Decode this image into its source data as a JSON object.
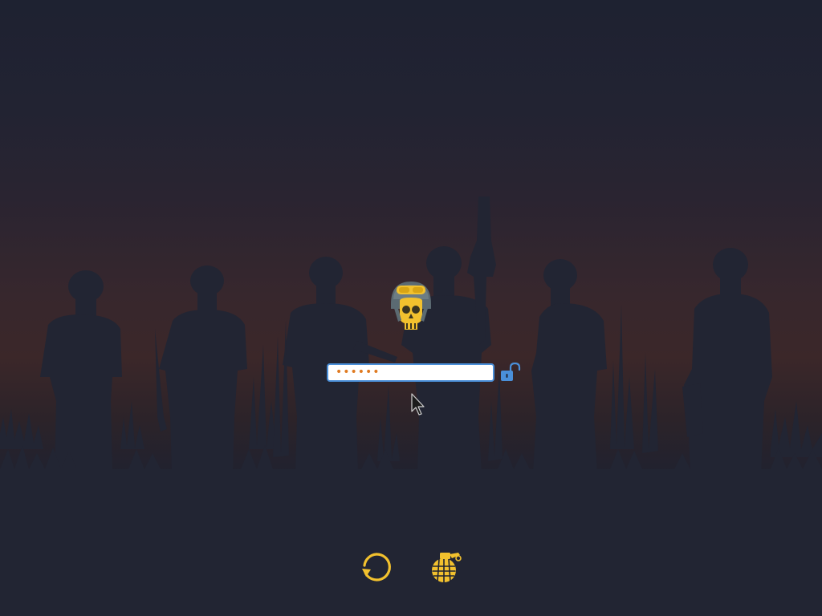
{
  "lockscreen": {
    "password": {
      "masked_value": "••••••",
      "mask_char_count": 6
    },
    "icons": {
      "avatar": "skull-helmet-icon",
      "unlock": "unlock-padlock-icon",
      "restart": "restart-icon",
      "grenade": "grenade-icon",
      "cursor": "mouse-pointer"
    },
    "colors": {
      "background_top": "#1e2231",
      "background_glow": "#3b2729",
      "silhouette": "#222533",
      "accent_yellow": "#f2c12e",
      "accent_blue": "#4a8fd9",
      "password_dot": "#e07b22"
    }
  }
}
